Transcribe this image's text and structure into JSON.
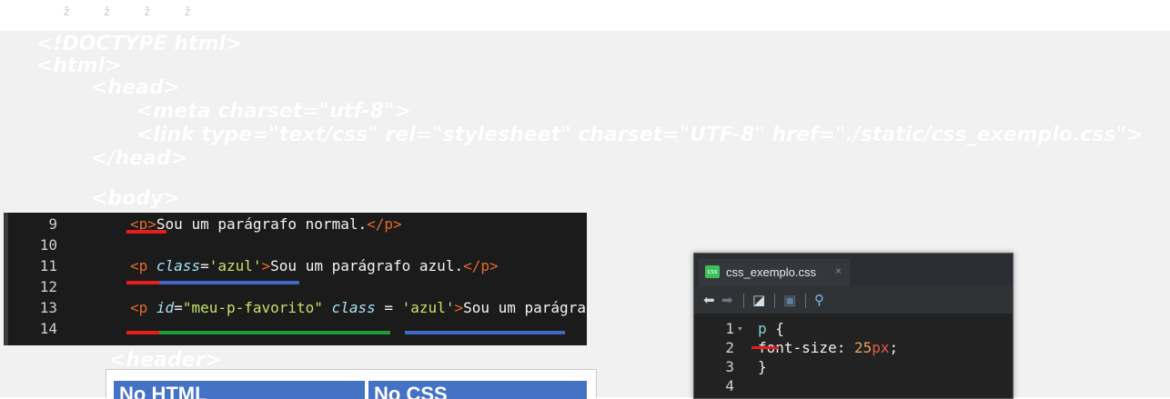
{
  "background_marks": [
    "ž",
    "ž",
    "ž",
    "ž"
  ],
  "background_code_lines": [
    "<!DOCTYPE html>",
    "<html>",
    "<head>",
    "<meta charset=\"utf-8\">",
    "<link type=\"text/css\" rel=\"stylesheet\" charset=\"UTF-8\" href=\"./static/css_exemplo.css\">",
    "</head>",
    "<body>",
    "<header>"
  ],
  "html_editor": {
    "lines": [
      {
        "number": "9",
        "parts": [
          {
            "t": "<p>",
            "c": "tag"
          },
          {
            "t": "Sou um parágrafo normal.",
            "c": "txt"
          },
          {
            "t": "</p>",
            "c": "tag"
          }
        ]
      },
      {
        "number": "10",
        "parts": []
      },
      {
        "number": "11",
        "parts": [
          {
            "t": "<p ",
            "c": "tag"
          },
          {
            "t": "class",
            "c": "attr"
          },
          {
            "t": "=",
            "c": "txt"
          },
          {
            "t": "'azul'",
            "c": "str"
          },
          {
            "t": ">",
            "c": "tag"
          },
          {
            "t": "Sou um parágrafo azul.",
            "c": "txt"
          },
          {
            "t": "</p>",
            "c": "tag"
          }
        ]
      },
      {
        "number": "12",
        "parts": []
      },
      {
        "number": "13",
        "parts": [
          {
            "t": "<p ",
            "c": "tag"
          },
          {
            "t": "id",
            "c": "attr"
          },
          {
            "t": "=",
            "c": "txt"
          },
          {
            "t": "\"meu-p-favorito\"",
            "c": "str"
          },
          {
            "t": " ",
            "c": "txt"
          },
          {
            "t": "class",
            "c": "attr"
          },
          {
            "t": " = ",
            "c": "txt"
          },
          {
            "t": "'azul'",
            "c": "str"
          },
          {
            "t": ">",
            "c": "tag"
          },
          {
            "t": "Sou um parágrafo favorito.",
            "c": "txt"
          }
        ]
      },
      {
        "number": "14",
        "parts": []
      }
    ]
  },
  "css_editor": {
    "tab_label": "css_exemplo.css",
    "tab_close": "×",
    "file_icon_label": "css",
    "toolbar_icons": [
      "back-arrow-icon",
      "forward-arrow-icon",
      "go-to-file-icon",
      "save-icon",
      "search-icon"
    ],
    "lines": [
      {
        "number": "1",
        "fold": "▾",
        "parts": [
          {
            "t": "p",
            "c": "sel"
          },
          {
            "t": " {",
            "c": "txt"
          }
        ]
      },
      {
        "number": "2",
        "fold": "",
        "parts": [
          {
            "t": "  font-size: ",
            "c": "txt"
          },
          {
            "t": "25",
            "c": "num"
          },
          {
            "t": "px",
            "c": "unit"
          },
          {
            "t": ";",
            "c": "txt"
          }
        ]
      },
      {
        "number": "3",
        "fold": "",
        "parts": [
          {
            "t": "}",
            "c": "txt"
          }
        ]
      },
      {
        "number": "4",
        "fold": "",
        "parts": []
      }
    ]
  },
  "table": {
    "headers": [
      "No HTML",
      "No CSS"
    ],
    "header_color": "#4472c4"
  },
  "colors": {
    "tag": "#e66a2c",
    "attr": "#a6e3f3",
    "string": "#c6e26b",
    "underline_red": "#e51d1d",
    "underline_blue": "#3f67c6",
    "underline_green": "#1f9b3a"
  }
}
